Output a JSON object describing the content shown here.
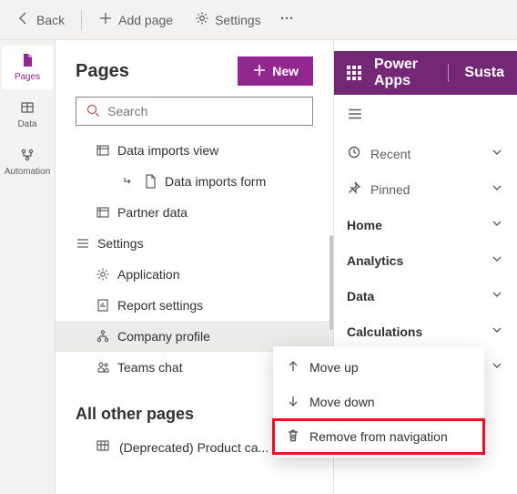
{
  "cmdbar": {
    "back": "Back",
    "add_page": "Add page",
    "settings": "Settings"
  },
  "rail": {
    "pages": "Pages",
    "data": "Data",
    "automation": "Automation"
  },
  "pages": {
    "title": "Pages",
    "new_label": "New",
    "search_placeholder": "Search",
    "tree": {
      "data_imports_view": "Data imports view",
      "data_imports_form": "Data imports form",
      "partner_data": "Partner data",
      "settings_group": "Settings",
      "application": "Application",
      "report_settings": "Report settings",
      "company_profile": "Company profile",
      "teams_chat": "Teams chat"
    },
    "other_pages_label": "All other pages",
    "other_row1": "(Deprecated) Product ca..."
  },
  "preview": {
    "brand": "Power Apps",
    "app_name": "Susta",
    "nav": {
      "recent": "Recent",
      "pinned": "Pinned",
      "home": "Home",
      "analytics": "Analytics",
      "data": "Data",
      "calculations": "Calculations"
    }
  },
  "ctx": {
    "move_up": "Move up",
    "move_down": "Move down",
    "remove": "Remove from navigation"
  }
}
